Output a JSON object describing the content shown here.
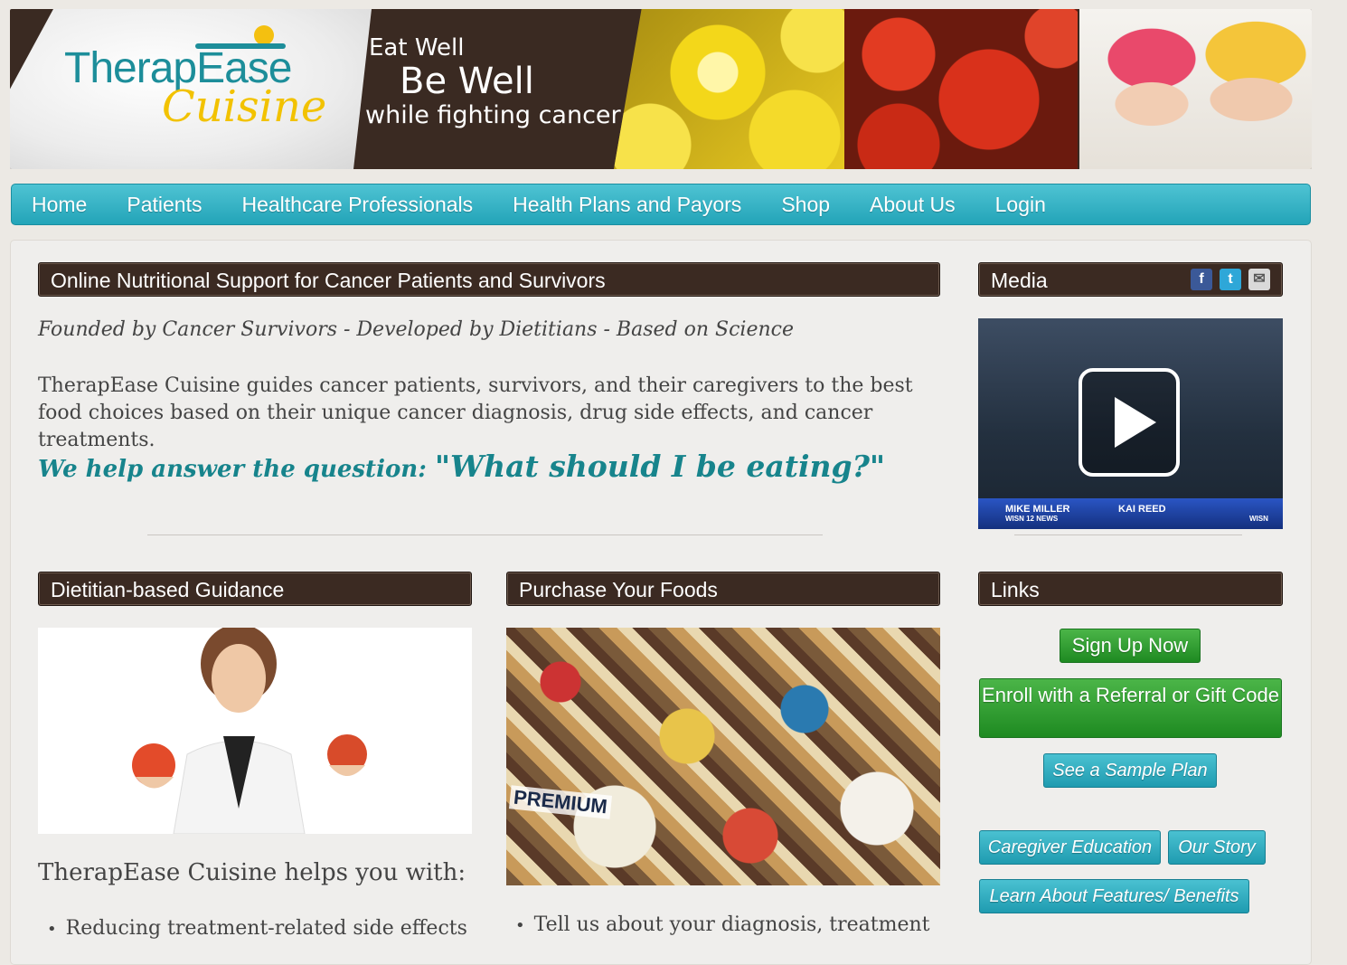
{
  "brand": {
    "logo_main": "TherapEase",
    "logo_sub": "Cuisine",
    "tagline_1": "Eat Well",
    "tagline_2": "Be Well",
    "tagline_3": "while fighting cancer"
  },
  "nav": {
    "items": [
      "Home",
      "Patients",
      "Healthcare Professionals",
      "Health Plans and Payors",
      "Shop",
      "About Us",
      "Login"
    ]
  },
  "main": {
    "heading": "Online Nutritional Support for Cancer Patients and Survivors",
    "founded": "Founded by Cancer Survivors - Developed by Dietitians - Based on Science",
    "intro": "TherapEase Cuisine guides cancer patients, survivors, and their caregivers to the best food choices based on their unique cancer diagnosis, drug side effects, and cancer treatments.",
    "question_lead": "We help answer the question: ",
    "question_main": "\"What should I be eating?\""
  },
  "media": {
    "heading": "Media",
    "video_names": [
      "MIKE MILLER",
      "KAI REED"
    ],
    "video_sub": [
      "WISN 12 NEWS",
      "WISN"
    ],
    "icons": [
      "facebook-icon",
      "twitter-icon",
      "email-icon"
    ]
  },
  "guidance": {
    "heading": "Dietitian-based Guidance",
    "list_title": "TherapEase Cuisine helps you with:",
    "bullets": [
      "Reducing treatment-related side effects"
    ]
  },
  "purchase": {
    "heading": "Purchase Your Foods",
    "image_label": "PREMIUM",
    "bullets": [
      "Tell us about your diagnosis, treatment"
    ]
  },
  "links": {
    "heading": "Links",
    "sign_up": "Sign Up Now",
    "enroll": "Enroll with a Referral or Gift Code",
    "sample_plan": "See a Sample Plan",
    "caregiver": "Caregiver Education",
    "our_story": "Our Story",
    "features": "Learn About Features/ Benefits"
  }
}
